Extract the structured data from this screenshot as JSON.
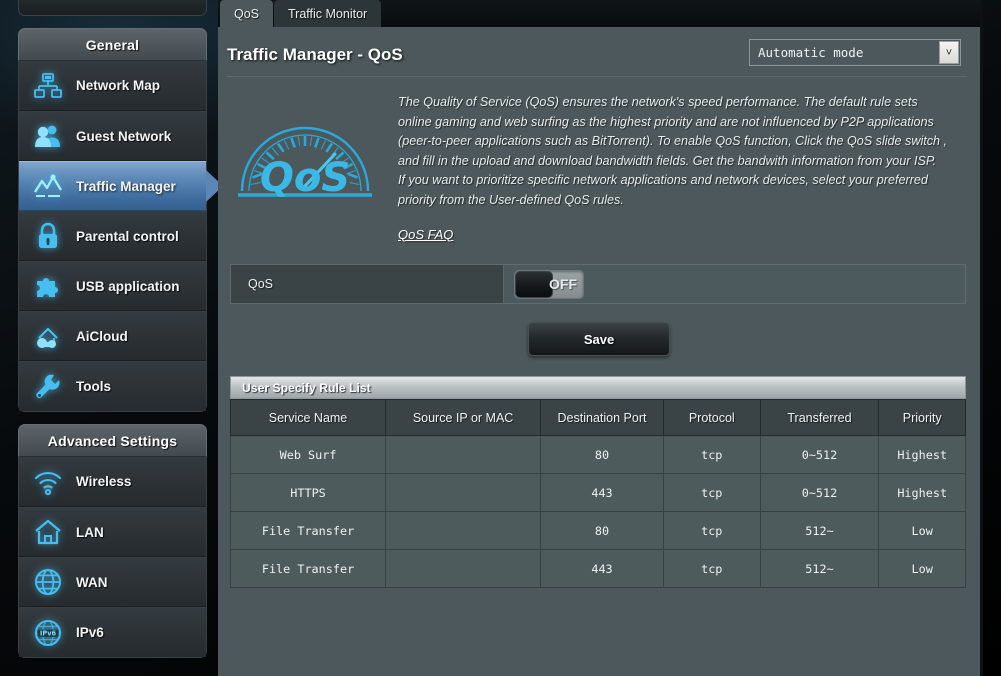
{
  "sidebar": {
    "groups": [
      {
        "header": "General",
        "items": [
          {
            "label": "Network Map",
            "icon": "network-map-icon",
            "active": false
          },
          {
            "label": "Guest Network",
            "icon": "guest-network-icon",
            "active": false
          },
          {
            "label": "Traffic Manager",
            "icon": "traffic-manager-icon",
            "active": true
          },
          {
            "label": "Parental control",
            "icon": "lock-icon",
            "active": false
          },
          {
            "label": "USB application",
            "icon": "puzzle-icon",
            "active": false
          },
          {
            "label": "AiCloud",
            "icon": "cloud-house-icon",
            "active": false
          },
          {
            "label": "Tools",
            "icon": "wrench-icon",
            "active": false
          }
        ]
      },
      {
        "header": "Advanced Settings",
        "items": [
          {
            "label": "Wireless",
            "icon": "wifi-icon",
            "active": false
          },
          {
            "label": "LAN",
            "icon": "house-icon",
            "active": false
          },
          {
            "label": "WAN",
            "icon": "globe-icon",
            "active": false
          },
          {
            "label": "IPv6",
            "icon": "ipv6-globe-icon",
            "active": false
          }
        ]
      }
    ]
  },
  "tabs": [
    {
      "label": "QoS",
      "active": true
    },
    {
      "label": "Traffic Monitor",
      "active": false
    }
  ],
  "header": {
    "title": "Traffic Manager - QoS"
  },
  "mode_select": {
    "value": "Automatic mode",
    "chevron": "˅"
  },
  "description": {
    "paragraph1": "The Quality of Service (QoS) ensures the network's speed performance. The default rule sets online gaming and web surfing as the highest priority and are not influenced by P2P applications (peer-to-peer applications such as BitTorrent). To enable QoS function, Click the QoS slide switch , and fill in the upload and download bandwidth fields. Get the bandwith information from your ISP.",
    "paragraph2": "If you want to prioritize specific network applications and network devices, select your preferred priority from the User-defined QoS rules.",
    "faq_link": "QoS FAQ",
    "logo_text": "QoS"
  },
  "qos_row": {
    "label": "QoS",
    "switch_state": "OFF"
  },
  "save_button": "Save",
  "table": {
    "caption": "User Specify Rule List",
    "columns": [
      "Service Name",
      "Source IP or MAC",
      "Destination Port",
      "Protocol",
      "Transferred",
      "Priority"
    ],
    "rows": [
      [
        "Web Surf",
        "",
        "80",
        "tcp",
        "0~512",
        "Highest"
      ],
      [
        "HTTPS",
        "",
        "443",
        "tcp",
        "0~512",
        "Highest"
      ],
      [
        "File Transfer",
        "",
        "80",
        "tcp",
        "512~",
        "Low"
      ],
      [
        "File Transfer",
        "",
        "443",
        "tcp",
        "512~",
        "Low"
      ]
    ]
  },
  "colors": {
    "accent_blue": "#3f6d9e",
    "icon_cyan": "#46bef0",
    "panel_bg": "#4c585b",
    "sidebar_bg": "#2a2f33"
  }
}
